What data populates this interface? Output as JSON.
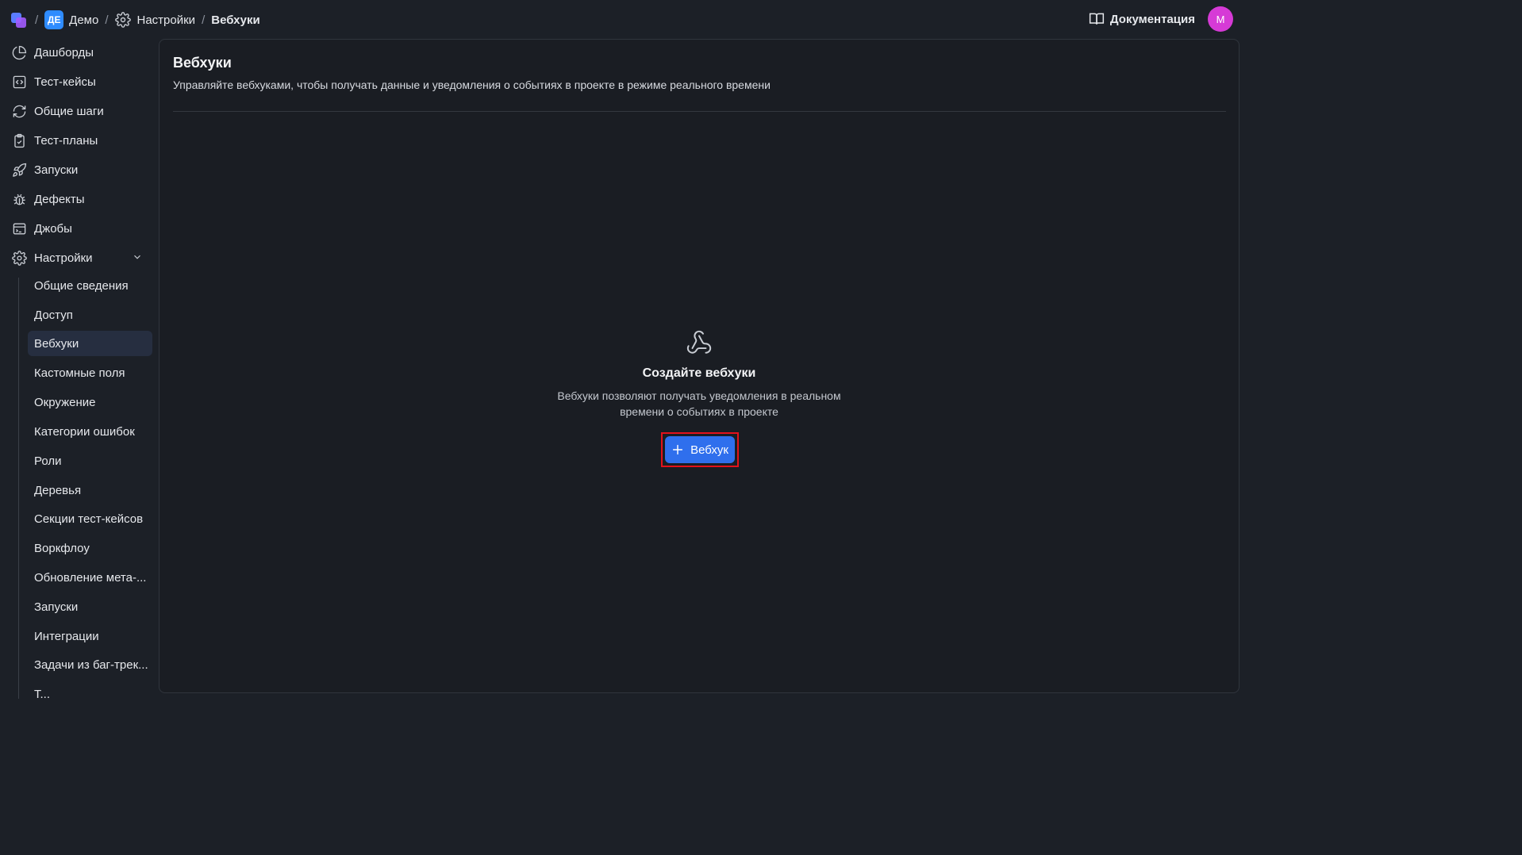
{
  "topbar": {
    "project_badge": "ДЕ",
    "project_name": "Демо",
    "settings_crumb": "Настройки",
    "current_crumb": "Вебхуки",
    "separator": "/",
    "docs_label": "Документация",
    "avatar_initial": "M"
  },
  "sidebar": {
    "items": [
      {
        "label": "Дашборды",
        "icon": "pie-chart-icon"
      },
      {
        "label": "Тест-кейсы",
        "icon": "code-square-icon"
      },
      {
        "label": "Общие шаги",
        "icon": "refresh-icon"
      },
      {
        "label": "Тест-планы",
        "icon": "clipboard-check-icon"
      },
      {
        "label": "Запуски",
        "icon": "rocket-icon"
      },
      {
        "label": "Дефекты",
        "icon": "bug-icon"
      },
      {
        "label": "Джобы",
        "icon": "terminal-icon"
      },
      {
        "label": "Настройки",
        "icon": "gear-icon"
      }
    ],
    "settings_items": [
      "Общие сведения",
      "Доступ",
      "Вебхуки",
      "Кастомные поля",
      "Окружение",
      "Категории ошибок",
      "Роли",
      "Деревья",
      "Секции тест-кейсов",
      "Воркфлоу",
      "Обновление мета-...",
      "Запуски",
      "Интеграции",
      "Задачи из баг-трек...",
      "Т..."
    ],
    "active_settings_item": "Вебхуки"
  },
  "main": {
    "title": "Вебхуки",
    "description": "Управляйте вебхуками, чтобы получать данные и уведомления о событиях в проекте в режиме реального времени",
    "empty_state": {
      "icon": "webhook-icon",
      "title": "Создайте вебхуки",
      "description_line1": "Вебхуки позволяют получать уведомления в реальном",
      "description_line2": "времени о событиях в проекте",
      "button_label": "Вебхук"
    }
  },
  "colors": {
    "background": "#1c2027",
    "panel": "#1a1d23",
    "accent": "#2f6fed",
    "highlight_border": "#e3121b",
    "active_item": "#262e40",
    "avatar": "#d63ad6"
  }
}
